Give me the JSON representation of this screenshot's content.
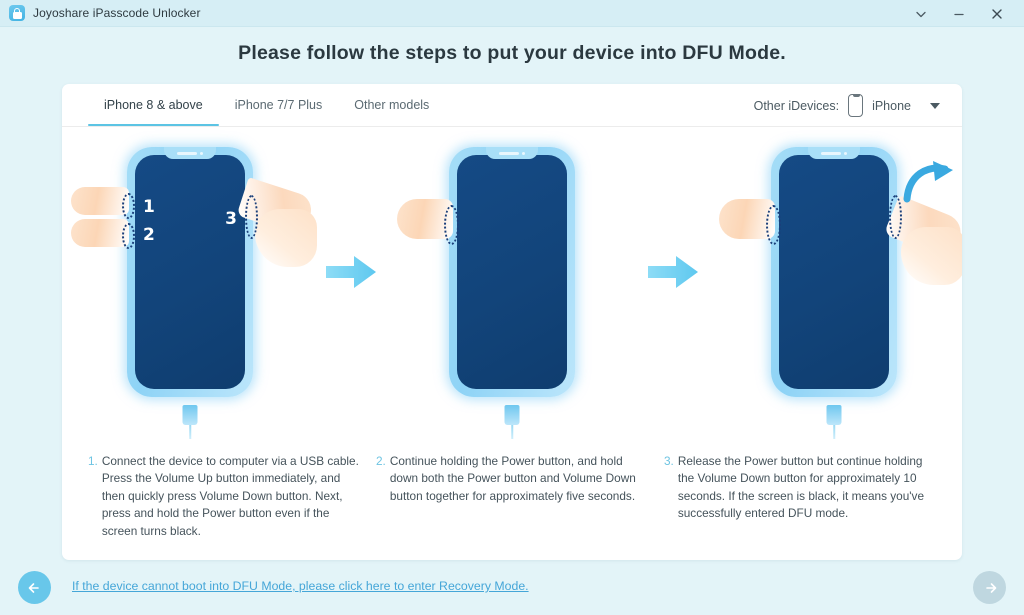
{
  "titlebar": {
    "app_name": "Joyoshare iPasscode Unlocker",
    "app_icon": "padlock-icon",
    "controls": [
      {
        "name": "menu-chevron-icon",
        "glyph": "chevron-down"
      },
      {
        "name": "minimize-icon",
        "glyph": "minimize"
      },
      {
        "name": "close-icon",
        "glyph": "close"
      }
    ]
  },
  "header": {
    "title": "Please follow the steps to put your device into DFU Mode."
  },
  "tabs": [
    {
      "label": "iPhone 8 & above",
      "active": true
    },
    {
      "label": "iPhone 7/7 Plus",
      "active": false
    },
    {
      "label": "Other models",
      "active": false
    }
  ],
  "device_picker": {
    "label": "Other iDevices:",
    "icon": "phone-outline-icon",
    "selected": "iPhone",
    "caret": "caret-down-icon"
  },
  "illustrations": {
    "phone1": {
      "button_markers": [
        "1",
        "2",
        "3"
      ],
      "alt": "iPhone with fingers on Volume Up, Volume Down and Power buttons"
    },
    "phone2": {
      "alt": "iPhone with finger holding Volume Down button"
    },
    "phone3": {
      "alt": "iPhone with Power button being released"
    },
    "arrow": "right-arrow-icon",
    "release_arrow": "curved-release-arrow-icon"
  },
  "steps": [
    {
      "index": "1.",
      "text": "Connect the device to computer via a USB cable. Press the Volume Up button immediately, and then quickly press Volume Down button. Next, press and hold the Power button even if the screen turns black."
    },
    {
      "index": "2.",
      "text": "Continue holding the Power button, and hold down both the Power button and Volume Down button together for approximately five seconds."
    },
    {
      "index": "3.",
      "text": "Release the Power button but continue holding the Volume Down button for approximately 10 seconds. If the screen is black, it means you've successfully entered DFU mode."
    }
  ],
  "bottom": {
    "link": "If the device cannot boot into DFU Mode, please click here to enter Recovery Mode.",
    "back_icon": "arrow-left-icon",
    "next_icon": "arrow-right-icon"
  },
  "colors": {
    "page_background": "#e3f4f8",
    "titlebar": "#d6eef5",
    "card": "#ffffff",
    "accent": "#5cc4e4",
    "link": "#45a6d8",
    "phone_screen": "#12447a",
    "phone_frame": "#8ed3f6",
    "next_disabled": "#bfd7e0"
  }
}
